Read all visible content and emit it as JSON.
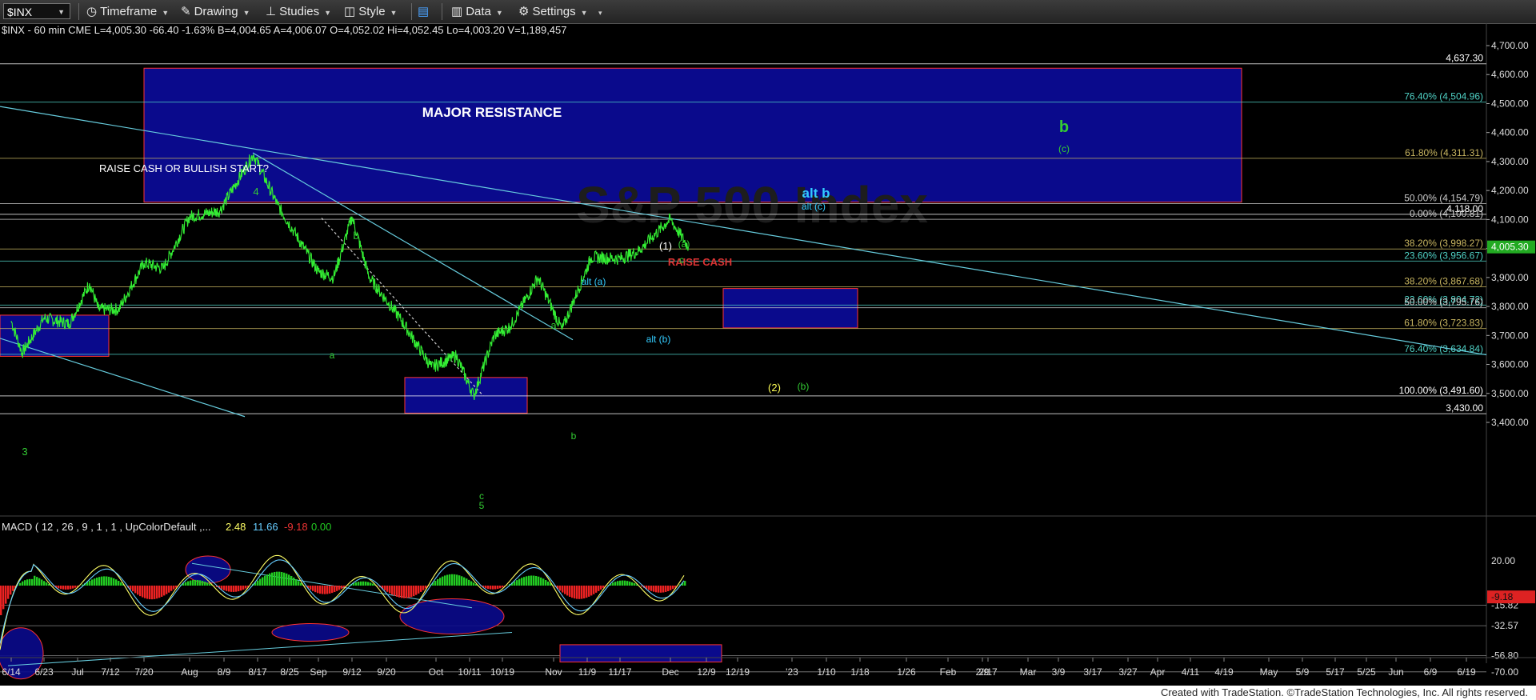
{
  "toolbar": {
    "symbol": "$INX",
    "timeframe": "Timeframe",
    "drawing": "Drawing",
    "studies": "Studies",
    "style": "Style",
    "data": "Data",
    "settings": "Settings"
  },
  "info_line": "$INX - 60 min  CME  L=4,005.30  -66.40  -1.63%  B=4,004.65  A=4,006.07  O=4,052.02  Hi=4,052.45  Lo=4,003.20  V=1,189,457",
  "macd_label": {
    "name": "MACD ( 12 , 26 , 9 , 1 , 1 , UpColorDefault ,...",
    "v1": "2.48",
    "v2": "11.66",
    "v3": "-9.18",
    "v4": "0.00"
  },
  "footer": "Created with TradeStation. ©TradeStation Technologies, Inc. All rights reserved.",
  "chart_data": [
    {
      "type": "line",
      "title": "$INX - 60 min",
      "y_ticks": [
        3400,
        3500,
        3600,
        3700,
        3800,
        3900,
        4000,
        4100,
        4200,
        4300,
        4400,
        4500,
        4600,
        4700
      ],
      "y_tick_labels": [
        "3,400.00",
        "3,500.00",
        "3,600.00",
        "3,700.00",
        "3,800.00",
        "3,900.00",
        "4,000.00",
        "4,100.00",
        "4,200.00",
        "4,300.00",
        "4,400.00",
        "4,500.00",
        "4,600.00",
        "4,700.00"
      ],
      "ylim": [
        3383,
        4720
      ],
      "x_labels": [
        "6/14",
        "6/23",
        "Jul",
        "7/12",
        "7/20",
        "Aug",
        "8/9",
        "8/17",
        "8/25",
        "Sep",
        "9/12",
        "9/20",
        "Oct",
        "10/11",
        "10/19",
        "Nov",
        "11/9",
        "11/17",
        "Dec",
        "12/9",
        "12/19",
        "'23",
        "1/10",
        "1/18",
        "1/26",
        "Feb",
        "2/9",
        "2/17",
        "Mar",
        "3/9",
        "3/17",
        "3/27",
        "Apr",
        "4/11",
        "4/19",
        "May",
        "5/9",
        "5/17",
        "5/25",
        "Jun",
        "6/9",
        "6/19"
      ],
      "series": [
        {
          "color": "#33ee33",
          "x": [
            "6/14",
            "6/17",
            "6/23",
            "6/29",
            "7/5",
            "7/8",
            "7/14",
            "7/20",
            "7/25",
            "8/1",
            "8/8",
            "8/16",
            "8/22",
            "8/26",
            "9/1",
            "9/6",
            "9/12",
            "9/16",
            "9/23",
            "9/30",
            "10/7",
            "10/12",
            "10/17",
            "10/21",
            "10/28",
            "11/3",
            "11/10",
            "11/17",
            "11/22",
            "11/30",
            "12/1",
            "12/5"
          ],
          "y": [
            3750,
            3640,
            3760,
            3740,
            3880,
            3790,
            3790,
            3950,
            3930,
            4110,
            4130,
            4325,
            4150,
            4060,
            3920,
            3900,
            4110,
            3900,
            3760,
            3590,
            3630,
            3492,
            3700,
            3730,
            3900,
            3720,
            3970,
            3965,
            3990,
            4090,
            4100,
            4005
          ]
        }
      ],
      "price_labels": [
        {
          "text": "4,637.30",
          "value": 4637.3,
          "color": "#ffffff"
        },
        {
          "text": "76.40% (4,504.96)",
          "value": 4504.96,
          "color": "#4fd1c5"
        },
        {
          "text": "61.80% (4,311.31)",
          "value": 4311.31,
          "color": "#c8b560"
        },
        {
          "text": "50.00% (4,154.79)",
          "value": 4154.79,
          "color": "#cccccc"
        },
        {
          "text": "4,118.00",
          "value": 4118,
          "color": "#ffffff"
        },
        {
          "text": "0.00% (4,100.81)",
          "value": 4100.81,
          "color": "#cccccc"
        },
        {
          "text": "38.20% (3,998.27)",
          "value": 3998.27,
          "color": "#c8b560"
        },
        {
          "text": "23.60% (3,956.67)",
          "value": 3956.67,
          "color": "#4fd1c5"
        },
        {
          "text": "38.20% (3,867.68)",
          "value": 3867.68,
          "color": "#c8b560"
        },
        {
          "text": "23.60% (3,804.72)",
          "value": 3804.72,
          "color": "#4fd1c5"
        },
        {
          "text": "50.00% (3,795.76)",
          "value": 3795.76,
          "color": "#cccccc"
        },
        {
          "text": "61.80% (3,723.83)",
          "value": 3723.83,
          "color": "#c8b560"
        },
        {
          "text": "76.40% (3,634.84)",
          "value": 3634.84,
          "color": "#4fd1c5"
        },
        {
          "text": "100.00% (3,491.60)",
          "value": 3491.6,
          "color": "#ffffff"
        },
        {
          "text": "3,430.00",
          "value": 3430,
          "color": "#ffffff"
        }
      ],
      "last_price": {
        "text": "4,005.30",
        "value": 4005.3,
        "color": "#22aa22"
      },
      "annotations": [
        {
          "text": "MAJOR RESISTANCE",
          "color": "#ffffff"
        },
        {
          "text": "RAISE CASH OR BULLISH START?",
          "color": "#ffffff"
        },
        {
          "text": "RAISE CASH",
          "color": "#dd3333"
        },
        {
          "text": "b",
          "color": "#33cc33"
        },
        {
          "text": "(c)",
          "color": "#33cc33"
        },
        {
          "text": "alt b",
          "color": "#33ccff"
        },
        {
          "text": "alt (c)",
          "color": "#33ccff"
        },
        {
          "text": "4",
          "color": "#33cc33"
        },
        {
          "text": "b",
          "color": "#33cc33"
        },
        {
          "text": "a",
          "color": "#33cc33"
        },
        {
          "text": "(1)",
          "color": "#ffffff"
        },
        {
          "text": "(a)",
          "color": "#33cc33"
        },
        {
          "text": "c",
          "color": "#33cc33"
        },
        {
          "text": "alt (a)",
          "color": "#33ccff"
        },
        {
          "text": "alt (b)",
          "color": "#33ccff"
        },
        {
          "text": "a",
          "color": "#33cc33"
        },
        {
          "text": "b",
          "color": "#33cc33"
        },
        {
          "text": "(2)",
          "color": "#ffff55"
        },
        {
          "text": "(b)",
          "color": "#33cc33"
        },
        {
          "text": "3",
          "color": "#33cc33"
        },
        {
          "text": "c",
          "color": "#33cc33"
        },
        {
          "text": "5",
          "color": "#33cc33"
        }
      ]
    },
    {
      "type": "bar",
      "title": "MACD ( 12 , 26 , 9 , 1 , 1 , UpColorDefault ,...",
      "y_tick_labels": [
        "20.00",
        "-15.82",
        "-32.57",
        "-56.80",
        "-70.00"
      ],
      "y_ticks": [
        20,
        -15.82,
        -32.57,
        -56.8,
        -70
      ],
      "ylim": [
        -80,
        35
      ],
      "last_value": {
        "text": "-9.18",
        "value": -9.18,
        "color": "#dd2222"
      },
      "colors": {
        "up": "#22cc22",
        "down": "#ee2222",
        "macd": "#ffff66",
        "signal": "#66ccff"
      }
    }
  ]
}
